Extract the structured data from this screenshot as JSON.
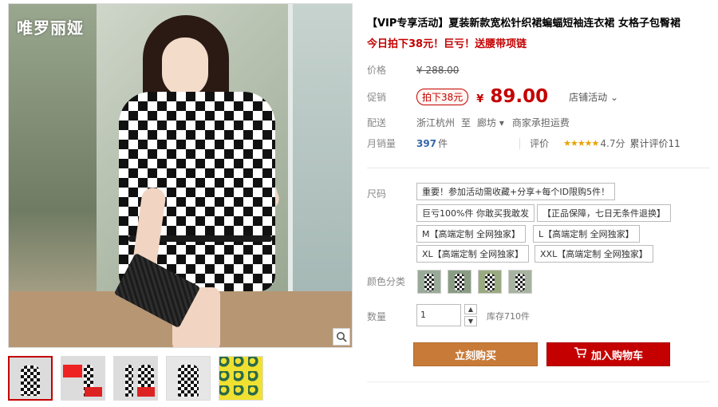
{
  "gallery": {
    "brand": "唯罗丽娅",
    "zoom_icon": "magnifier-icon",
    "thumbnail_count": 5
  },
  "product": {
    "title": "【VIP专享活动】夏装新款宽松针织裙蝙蝠短袖连衣裙 女格子包臀裙",
    "promo": "今日拍下38元！巨亏！送腰带项链"
  },
  "price": {
    "label": "价格",
    "original": "¥ 288.00"
  },
  "promo_price": {
    "label": "促销",
    "tag": "拍下38元",
    "currency": "¥",
    "value": "89.00",
    "store_activity": "店铺活动"
  },
  "shipping": {
    "label": "配送",
    "from": "浙江杭州",
    "to_word": "至",
    "destination": "廊坊",
    "note": "商家承担运费"
  },
  "sales": {
    "label": "月销量",
    "count": "397",
    "unit": "件",
    "rating_label": "评价",
    "stars": "★★★★★",
    "score": "4.7分",
    "cumulative": "累计评价11"
  },
  "size": {
    "label": "尺码",
    "options": [
      "重要！参加活动需收藏+分享+每个ID限购5件！",
      "巨亏100%件 你敢买我敢发",
      "【正品保障，七日无条件退换】",
      "M【高端定制 全网独家】",
      "L【高端定制 全网独家】",
      "XL【高端定制 全网独家】",
      "XXL【高端定制 全网独家】"
    ]
  },
  "color": {
    "label": "颜色分类",
    "swatch_count": 4
  },
  "quantity": {
    "label": "数量",
    "value": "1",
    "stock": "库存710件"
  },
  "actions": {
    "buy_now": "立刻购买",
    "add_to_cart": "加入购物车",
    "cart_icon": "cart-icon"
  },
  "colors": {
    "price_red": "#c40000",
    "buy_orange": "#c87b39",
    "cart_red": "#c40000"
  }
}
